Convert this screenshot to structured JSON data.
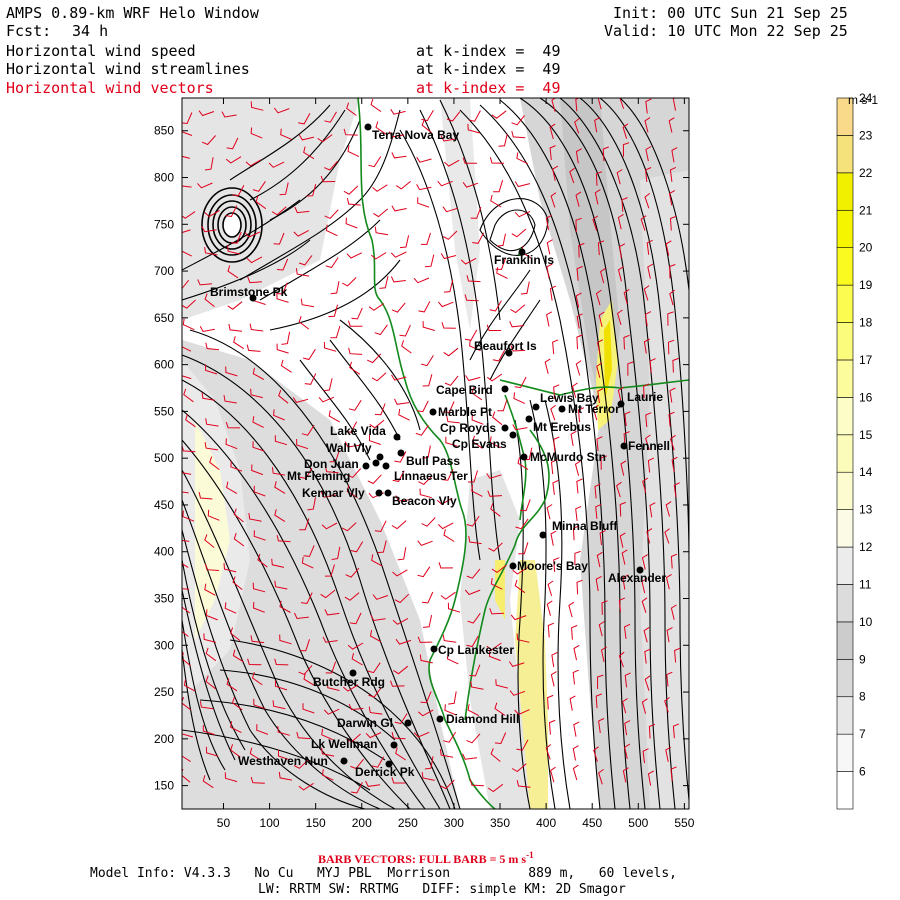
{
  "header": {
    "title": "AMPS 0.89-km WRF Helo Window",
    "forecast_label": "Fcst:",
    "forecast_hours": "34 h",
    "init": "Init: 00 UTC Sun 21 Sep 25",
    "valid": "Valid: 10 UTC Mon 22 Sep 25",
    "fields": [
      {
        "name": "Horizontal wind speed",
        "level": "at k-index =  49",
        "color": "#000000"
      },
      {
        "name": "Horizontal wind streamlines",
        "level": "at k-index =  49",
        "color": "#000000"
      },
      {
        "name": "Horizontal wind vectors",
        "level": "at k-index =  49",
        "color": "#e0001b"
      }
    ]
  },
  "axes": {
    "x_ticks": [
      "50",
      "100",
      "150",
      "200",
      "250",
      "300",
      "350",
      "400",
      "450",
      "500",
      "550"
    ],
    "y_ticks": [
      "150",
      "200",
      "250",
      "300",
      "350",
      "400",
      "450",
      "500",
      "550",
      "600",
      "650",
      "700",
      "750",
      "800",
      "850"
    ],
    "x_range": [
      5,
      555
    ],
    "y_range": [
      125,
      885
    ]
  },
  "colorbar": {
    "unit": "m s-1",
    "levels": [
      "6",
      "7",
      "8",
      "9",
      "10",
      "11",
      "12",
      "13",
      "14",
      "15",
      "16",
      "17",
      "18",
      "19",
      "20",
      "21",
      "22",
      "23",
      "24"
    ],
    "colors": [
      "#ffffff",
      "#f7f7f7",
      "#e8e8e8",
      "#d9d9d9",
      "#cccccc",
      "#dcdcdc",
      "#ececec",
      "#fbfbe6",
      "#fcfcd0",
      "#fcfcba",
      "#fdfdc8",
      "#fcfc9c",
      "#fbfb7c",
      "#fbfb50",
      "#fafa20",
      "#f5f500",
      "#f0f000",
      "#f5e27a",
      "#f8da8a"
    ]
  },
  "stations": [
    {
      "name": "Terra Nova Bay",
      "x": 0,
      "y": 0
    },
    {
      "name": "Franklin Is",
      "x": 0,
      "y": 0
    },
    {
      "name": "Brimstone Pk",
      "x": 0,
      "y": 0
    },
    {
      "name": "Beaufort Is",
      "x": 0,
      "y": 0
    },
    {
      "name": "Cape Bird",
      "x": 0,
      "y": 0
    },
    {
      "name": "Lewis Bay",
      "x": 0,
      "y": 0
    },
    {
      "name": "Laurie",
      "x": 0,
      "y": 0
    },
    {
      "name": "Marble Pt",
      "x": 0,
      "y": 0
    },
    {
      "name": "Mt Terror",
      "x": 0,
      "y": 0
    },
    {
      "name": "Cp Royds",
      "x": 0,
      "y": 0
    },
    {
      "name": "Mt Erebus",
      "x": 0,
      "y": 0
    },
    {
      "name": "Cp Evans",
      "x": 0,
      "y": 0
    },
    {
      "name": "Lake Vida",
      "x": 0,
      "y": 0
    },
    {
      "name": "Fennell",
      "x": 0,
      "y": 0
    },
    {
      "name": "Wall Vly",
      "x": 0,
      "y": 0
    },
    {
      "name": "McMurdo Stn",
      "x": 0,
      "y": 0
    },
    {
      "name": "Don Juan",
      "x": 0,
      "y": 0
    },
    {
      "name": "Bull Pass",
      "x": 0,
      "y": 0
    },
    {
      "name": "Mt Fleming",
      "x": 0,
      "y": 0
    },
    {
      "name": "Linnaeus Ter",
      "x": 0,
      "y": 0
    },
    {
      "name": "Kennar Vly",
      "x": 0,
      "y": 0
    },
    {
      "name": "Beacon Vly",
      "x": 0,
      "y": 0
    },
    {
      "name": "Minna Bluff",
      "x": 0,
      "y": 0
    },
    {
      "name": "Moore's Bay",
      "x": 0,
      "y": 0
    },
    {
      "name": "Alexander",
      "x": 0,
      "y": 0
    },
    {
      "name": "Cp Lankester",
      "x": 0,
      "y": 0
    },
    {
      "name": "Butcher Rdg",
      "x": 0,
      "y": 0
    },
    {
      "name": "Diamond Hill",
      "x": 0,
      "y": 0
    },
    {
      "name": "Darwin Gl",
      "x": 0,
      "y": 0
    },
    {
      "name": "Lk Wellman",
      "x": 0,
      "y": 0
    },
    {
      "name": "Westhaven Nun",
      "x": 0,
      "y": 0
    },
    {
      "name": "Derrick Pk",
      "x": 0,
      "y": 0
    }
  ],
  "footer": {
    "barb_note": "BARB VECTORS:  FULL BARB = 5 m s",
    "barb_unit_sup": "-1",
    "model_line1": "Model Info: V4.3.3   No Cu   MYJ PBL  Morrison          889 m,   60 levels,",
    "model_line2": "LW: RRTM SW: RRTMG   DIFF: simple KM: 2D Smagor"
  }
}
